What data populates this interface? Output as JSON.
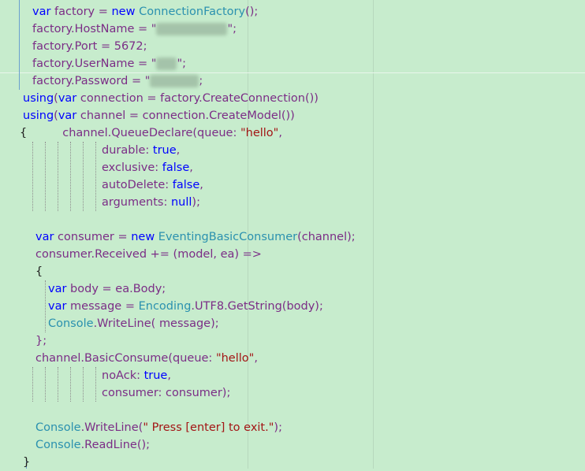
{
  "editor": {
    "background": "#c7eccd",
    "colors": {
      "keyword": "#0000ff",
      "type": "#2b91af",
      "identifier": "#7b2d86",
      "string": "#a31515"
    },
    "lines": [
      {
        "indent": 41,
        "tokens": [
          {
            "t": "var",
            "c": "kw"
          },
          {
            "t": " factory = ",
            "c": "id"
          },
          {
            "t": "new",
            "c": "kw"
          },
          {
            "t": " ",
            "c": "pl"
          },
          {
            "t": "ConnectionFactory",
            "c": "ty"
          },
          {
            "t": "();",
            "c": "id"
          }
        ]
      },
      {
        "indent": 41,
        "tokens": [
          {
            "t": "factory.HostName = \"",
            "c": "id"
          },
          {
            "blur": 90
          },
          {
            "t": "\";",
            "c": "id"
          }
        ]
      },
      {
        "indent": 41,
        "tokens": [
          {
            "t": "factory.Port = 5672;",
            "c": "id"
          }
        ]
      },
      {
        "indent": 41,
        "tokens": [
          {
            "t": "factory.UserName = \"",
            "c": "id"
          },
          {
            "blur": 26
          },
          {
            "t": "\";",
            "c": "id"
          }
        ]
      },
      {
        "indent": 41,
        "tokens": [
          {
            "t": "factory.Password = \"",
            "c": "id"
          },
          {
            "blur": 62
          },
          {
            "t": ";",
            "c": "id"
          }
        ]
      },
      {
        "indent": 29,
        "tokens": [
          {
            "t": "using",
            "c": "kw"
          },
          {
            "t": "(",
            "c": "id"
          },
          {
            "t": "var",
            "c": "kw"
          },
          {
            "t": " connection = factory.CreateConnection())",
            "c": "id"
          }
        ]
      },
      {
        "indent": 29,
        "tokens": [
          {
            "t": "using",
            "c": "kw"
          },
          {
            "t": "(",
            "c": "id"
          },
          {
            "t": "var",
            "c": "kw"
          },
          {
            "t": " channel = connection.CreateModel())",
            "c": "id"
          }
        ]
      },
      {
        "indent": 25,
        "tokens": [
          {
            "t": "{",
            "c": "pl"
          },
          {
            "gap": 45
          },
          {
            "t": "channel.QueueDeclare(queue: ",
            "c": "id"
          },
          {
            "t": "\"hello\"",
            "c": "str"
          },
          {
            "t": ",",
            "c": "id"
          }
        ]
      },
      {
        "indent": 129,
        "tokens": [
          {
            "t": "durable: ",
            "c": "id"
          },
          {
            "t": "true",
            "c": "kw"
          },
          {
            "t": ",",
            "c": "id"
          }
        ]
      },
      {
        "indent": 129,
        "tokens": [
          {
            "t": "exclusive: ",
            "c": "id"
          },
          {
            "t": "false",
            "c": "kw"
          },
          {
            "t": ",",
            "c": "id"
          }
        ]
      },
      {
        "indent": 129,
        "tokens": [
          {
            "t": "autoDelete: ",
            "c": "id"
          },
          {
            "t": "false",
            "c": "kw"
          },
          {
            "t": ",",
            "c": "id"
          }
        ]
      },
      {
        "indent": 129,
        "tokens": [
          {
            "t": "arguments: ",
            "c": "id"
          },
          {
            "t": "null",
            "c": "kw"
          },
          {
            "t": ");",
            "c": "id"
          }
        ]
      },
      {
        "indent": 45,
        "tokens": []
      },
      {
        "indent": 45,
        "tokens": [
          {
            "t": "var",
            "c": "kw"
          },
          {
            "t": " consumer = ",
            "c": "id"
          },
          {
            "t": "new",
            "c": "kw"
          },
          {
            "t": " ",
            "c": "pl"
          },
          {
            "t": "EventingBasicConsumer",
            "c": "ty"
          },
          {
            "t": "(channel);",
            "c": "id"
          }
        ]
      },
      {
        "indent": 45,
        "tokens": [
          {
            "t": "consumer.Received += (model, ea) =>",
            "c": "id"
          }
        ]
      },
      {
        "indent": 45,
        "tokens": [
          {
            "t": "{",
            "c": "pl"
          }
        ]
      },
      {
        "indent": 61,
        "tokens": [
          {
            "t": "var",
            "c": "kw"
          },
          {
            "t": " body = ea.Body;",
            "c": "id"
          }
        ]
      },
      {
        "indent": 61,
        "tokens": [
          {
            "t": "var",
            "c": "kw"
          },
          {
            "t": " message = ",
            "c": "id"
          },
          {
            "t": "Encoding",
            "c": "ty"
          },
          {
            "t": ".UTF8.GetString(body);",
            "c": "id"
          }
        ]
      },
      {
        "indent": 61,
        "tokens": [
          {
            "t": "Console",
            "c": "ty"
          },
          {
            "t": ".WriteLine( message);",
            "c": "id"
          }
        ]
      },
      {
        "indent": 45,
        "tokens": [
          {
            "t": "};",
            "c": "id"
          }
        ]
      },
      {
        "indent": 45,
        "tokens": [
          {
            "t": "channel.BasicConsume(queue: ",
            "c": "id"
          },
          {
            "t": "\"hello\"",
            "c": "str"
          },
          {
            "t": ",",
            "c": "id"
          }
        ]
      },
      {
        "indent": 129,
        "tokens": [
          {
            "t": "noAck: ",
            "c": "id"
          },
          {
            "t": "true",
            "c": "kw"
          },
          {
            "t": ",",
            "c": "id"
          }
        ]
      },
      {
        "indent": 129,
        "tokens": [
          {
            "t": "consumer: consumer);",
            "c": "id"
          }
        ]
      },
      {
        "indent": 45,
        "tokens": []
      },
      {
        "indent": 45,
        "tokens": [
          {
            "t": "Console",
            "c": "ty"
          },
          {
            "t": ".WriteLine(",
            "c": "id"
          },
          {
            "t": "\" Press [enter] to exit.\"",
            "c": "str"
          },
          {
            "t": ");",
            "c": "id"
          }
        ]
      },
      {
        "indent": 45,
        "tokens": [
          {
            "t": "Console",
            "c": "ty"
          },
          {
            "t": ".ReadLine();",
            "c": "id"
          }
        ]
      },
      {
        "indent": 29,
        "tokens": [
          {
            "t": "}",
            "c": "pl"
          }
        ]
      }
    ]
  }
}
